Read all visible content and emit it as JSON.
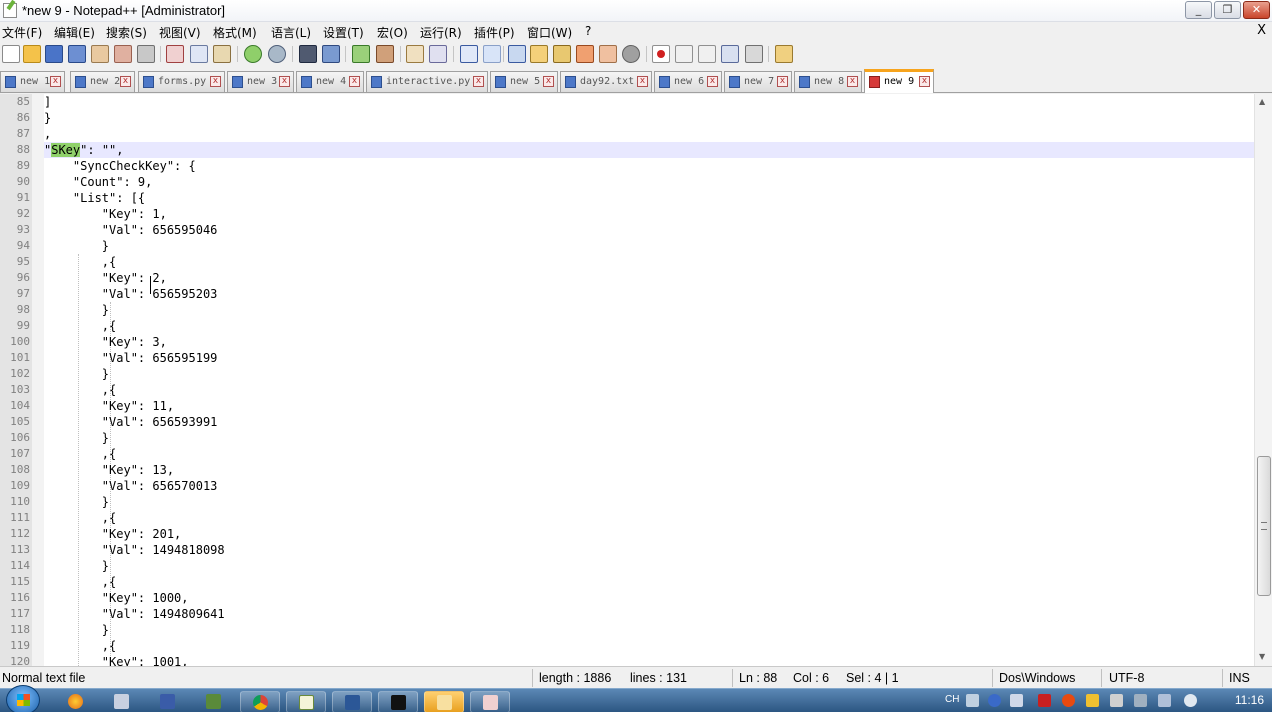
{
  "window": {
    "title": "*new 9 - Notepad++ [Administrator]",
    "minimize_label": "_",
    "maximize_label": "❐",
    "close_label": "✕"
  },
  "menubar": {
    "items": [
      "文件(F)",
      "编辑(E)",
      "搜索(S)",
      "视图(V)",
      "格式(M)",
      "语言(L)",
      "设置(T)",
      "宏(O)",
      "运行(R)",
      "插件(P)",
      "窗口(W)",
      "?"
    ],
    "close_doc_label": "X"
  },
  "toolbar": {
    "icons": [
      "new-file",
      "open-file",
      "save",
      "save-all",
      "close",
      "close-all",
      "print",
      "cut",
      "copy",
      "paste",
      "undo",
      "redo",
      "find",
      "replace",
      "zoom-in",
      "zoom-out",
      "sync-vertical",
      "sync-horizontal",
      "word-wrap",
      "show-all-chars",
      "indent-guide",
      "user-defined-language",
      "doc-map",
      "function-list",
      "folder-as-workspace",
      "monitoring",
      "record-macro",
      "stop-recording",
      "playback-macro",
      "run-macro-multiple",
      "save-macro",
      "plugin"
    ]
  },
  "tabs": [
    {
      "label": "new 1",
      "active": false
    },
    {
      "label": "new 2",
      "active": false
    },
    {
      "label": "forms.py",
      "active": false
    },
    {
      "label": "new 3",
      "active": false
    },
    {
      "label": "new 4",
      "active": false
    },
    {
      "label": "interactive.py",
      "active": false
    },
    {
      "label": "new 5",
      "active": false
    },
    {
      "label": "day92.txt",
      "active": false
    },
    {
      "label": "new 6",
      "active": false
    },
    {
      "label": "new 7",
      "active": false
    },
    {
      "label": "new 8",
      "active": false
    },
    {
      "label": "new 9",
      "active": true
    }
  ],
  "tab_close_label": "x",
  "editor": {
    "lines": [
      {
        "n": "85",
        "pre": "]",
        "hl": "",
        "post": ""
      },
      {
        "n": "86",
        "pre": "}",
        "hl": "",
        "post": ""
      },
      {
        "n": "87",
        "pre": ",",
        "hl": "",
        "post": ""
      },
      {
        "n": "88",
        "pre": "\"",
        "hl": "SKey",
        "post": "\": \"\","
      },
      {
        "n": "89",
        "pre": "    \"SyncCheckKey\": {",
        "hl": "",
        "post": ""
      },
      {
        "n": "90",
        "pre": "    \"Count\": 9,",
        "hl": "",
        "post": ""
      },
      {
        "n": "91",
        "pre": "    \"List\": [{",
        "hl": "",
        "post": ""
      },
      {
        "n": "92",
        "pre": "        \"Key\": 1,",
        "hl": "",
        "post": ""
      },
      {
        "n": "93",
        "pre": "        \"Val\": 656595046",
        "hl": "",
        "post": ""
      },
      {
        "n": "94",
        "pre": "        }",
        "hl": "",
        "post": ""
      },
      {
        "n": "95",
        "pre": "        ,{",
        "hl": "",
        "post": ""
      },
      {
        "n": "96",
        "pre": "        \"Key\": 2,",
        "hl": "",
        "post": ""
      },
      {
        "n": "97",
        "pre": "        \"Val\": 656595203",
        "hl": "",
        "post": ""
      },
      {
        "n": "98",
        "pre": "        }",
        "hl": "",
        "post": ""
      },
      {
        "n": "99",
        "pre": "        ,{",
        "hl": "",
        "post": ""
      },
      {
        "n": "100",
        "pre": "        \"Key\": 3,",
        "hl": "",
        "post": ""
      },
      {
        "n": "101",
        "pre": "        \"Val\": 656595199",
        "hl": "",
        "post": ""
      },
      {
        "n": "102",
        "pre": "        }",
        "hl": "",
        "post": ""
      },
      {
        "n": "103",
        "pre": "        ,{",
        "hl": "",
        "post": ""
      },
      {
        "n": "104",
        "pre": "        \"Key\": 11,",
        "hl": "",
        "post": ""
      },
      {
        "n": "105",
        "pre": "        \"Val\": 656593991",
        "hl": "",
        "post": ""
      },
      {
        "n": "106",
        "pre": "        }",
        "hl": "",
        "post": ""
      },
      {
        "n": "107",
        "pre": "        ,{",
        "hl": "",
        "post": ""
      },
      {
        "n": "108",
        "pre": "        \"Key\": 13,",
        "hl": "",
        "post": ""
      },
      {
        "n": "109",
        "pre": "        \"Val\": 656570013",
        "hl": "",
        "post": ""
      },
      {
        "n": "110",
        "pre": "        }",
        "hl": "",
        "post": ""
      },
      {
        "n": "111",
        "pre": "        ,{",
        "hl": "",
        "post": ""
      },
      {
        "n": "112",
        "pre": "        \"Key\": 201,",
        "hl": "",
        "post": ""
      },
      {
        "n": "113",
        "pre": "        \"Val\": 1494818098",
        "hl": "",
        "post": ""
      },
      {
        "n": "114",
        "pre": "        }",
        "hl": "",
        "post": ""
      },
      {
        "n": "115",
        "pre": "        ,{",
        "hl": "",
        "post": ""
      },
      {
        "n": "116",
        "pre": "        \"Key\": 1000,",
        "hl": "",
        "post": ""
      },
      {
        "n": "117",
        "pre": "        \"Val\": 1494809641",
        "hl": "",
        "post": ""
      },
      {
        "n": "118",
        "pre": "        }",
        "hl": "",
        "post": ""
      },
      {
        "n": "119",
        "pre": "        ,{",
        "hl": "",
        "post": ""
      },
      {
        "n": "120",
        "pre": "        \"Key\": 1001,",
        "hl": "",
        "post": ""
      }
    ],
    "current_line": "88"
  },
  "statusbar": {
    "file_type": "Normal text file",
    "length": "length : 1886",
    "lines": "lines : 131",
    "ln": "Ln : 88",
    "col": "Col : 6",
    "sel": "Sel : 4 | 1",
    "eol": "Dos\\Windows",
    "encoding": "UTF-8",
    "mode": "INS"
  },
  "taskbar": {
    "apps": [
      "firefox",
      "tool",
      "save",
      "network",
      "chrome",
      "notepad-plus-plus",
      "word",
      "pycharm",
      "folder",
      "paint"
    ],
    "lang": "CH",
    "clock": "11:16"
  },
  "colors": {
    "highlight": "#8fd16a",
    "current_line": "#e8e8ff",
    "active_tab_accent": "#f7a41d",
    "taskbar": "#2c5682"
  }
}
